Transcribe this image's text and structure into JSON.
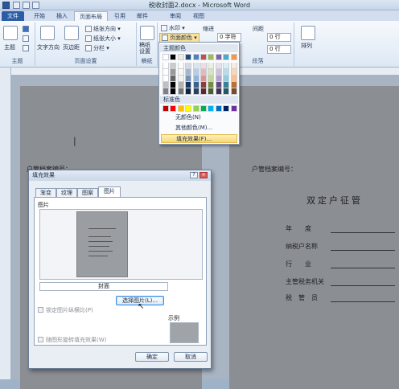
{
  "window": {
    "title": "税收封面2.docx - Microsoft Word"
  },
  "tabs": [
    "文件",
    "开始",
    "插入",
    "页面布局",
    "引用",
    "邮件",
    "审阅",
    "视图"
  ],
  "active_tab": "页面布局",
  "ribbon": {
    "themes_label": "主题",
    "text_direction": "文字方向",
    "margins": "页边距",
    "orientation": "纸张方向",
    "size": "纸张大小",
    "columns": "分栏",
    "page_setup": "页面设置",
    "watermark": "水印",
    "page_color": "页面颜色",
    "manuscript": "稿纸\n设置",
    "manuscript_group": "稿纸",
    "indent": "缩进",
    "spacing": "间距",
    "indent_value": "0 字符",
    "spacing_before": "0 行",
    "spacing_after": "0 行",
    "paragraph": "段落",
    "arrange": "排列"
  },
  "color_menu": {
    "theme_colors_label": "主题颜色",
    "standard_colors_label": "标准色",
    "no_color": "无颜色(N)",
    "more_colors": "其他颜色(M)...",
    "fill_effects": "填充效果(F)...",
    "theme_row": [
      "#ffffff",
      "#000000",
      "#eeece1",
      "#1f497d",
      "#4f81bd",
      "#c0504d",
      "#9bbb59",
      "#8064a2",
      "#4bacc6",
      "#f79646"
    ],
    "standard_row": [
      "#c00000",
      "#ff0000",
      "#ffc000",
      "#ffff00",
      "#92d050",
      "#00b050",
      "#00b0f0",
      "#0070c0",
      "#002060",
      "#7030a0"
    ]
  },
  "document": {
    "left_label": "户管档案编号：",
    "right_label": "户管档案编号：",
    "heading": "双定户征管",
    "fields": [
      "年　　度",
      "纳税户名称",
      "行　　业",
      "主管税务机关",
      "税　管　员"
    ]
  },
  "dialog": {
    "title": "填充效果",
    "tabs": [
      "渐变",
      "纹理",
      "图案",
      "图片"
    ],
    "active_tab": "图片",
    "picture_label": "图片",
    "picture_name": "封面",
    "select_button": "选择图片(L)...",
    "lock_aspect": "锁定图片纵横比(P)",
    "rotate_with_shape": "随图形旋转填充效果(W)",
    "sample_label": "示例",
    "ok": "确定",
    "cancel": "取消"
  }
}
